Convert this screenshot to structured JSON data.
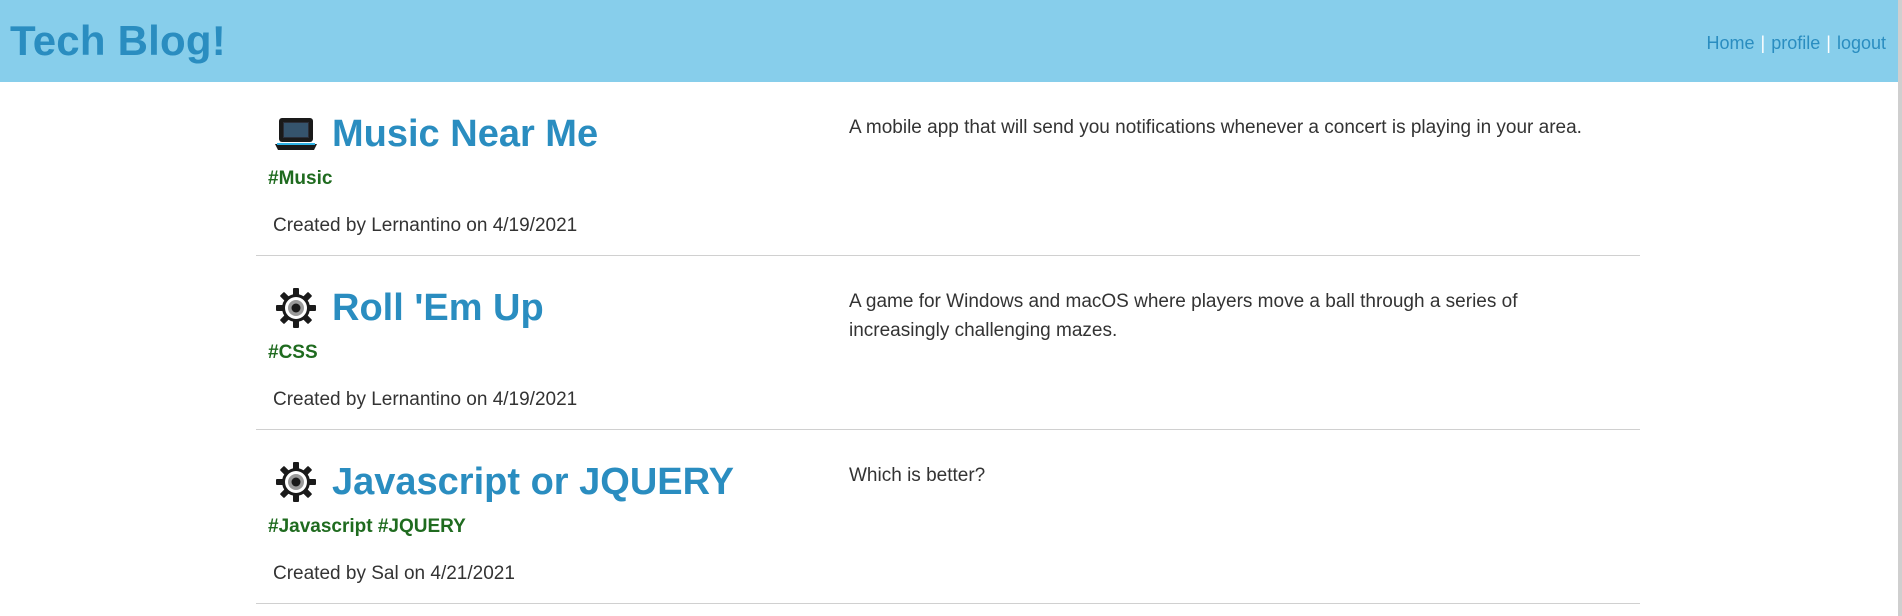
{
  "header": {
    "brand": "Tech Blog!",
    "nav": {
      "home": "Home",
      "separator": "|",
      "profile": "profile",
      "logout": "logout"
    }
  },
  "posts": [
    {
      "icon": "laptop-icon",
      "title": "Music Near Me",
      "tags": "#Music",
      "meta": "Created by Lernantino on 4/19/2021",
      "description": "A mobile app that will send you notifications whenever a concert is playing in your area."
    },
    {
      "icon": "gear-icon",
      "title": "Roll 'Em Up",
      "tags": "#CSS",
      "meta": "Created by Lernantino on 4/19/2021",
      "description": "A game for Windows and macOS where players move a ball through a series of increasingly challenging mazes."
    },
    {
      "icon": "gear-icon",
      "title": "Javascript or JQUERY",
      "tags": "#Javascript #JQUERY",
      "meta": "Created by Sal on 4/21/2021",
      "description": "Which is better?"
    }
  ],
  "colors": {
    "header_bg": "#87ceeb",
    "link": "#2a8dc0",
    "tag": "#1f6b1f",
    "text": "#333333"
  }
}
